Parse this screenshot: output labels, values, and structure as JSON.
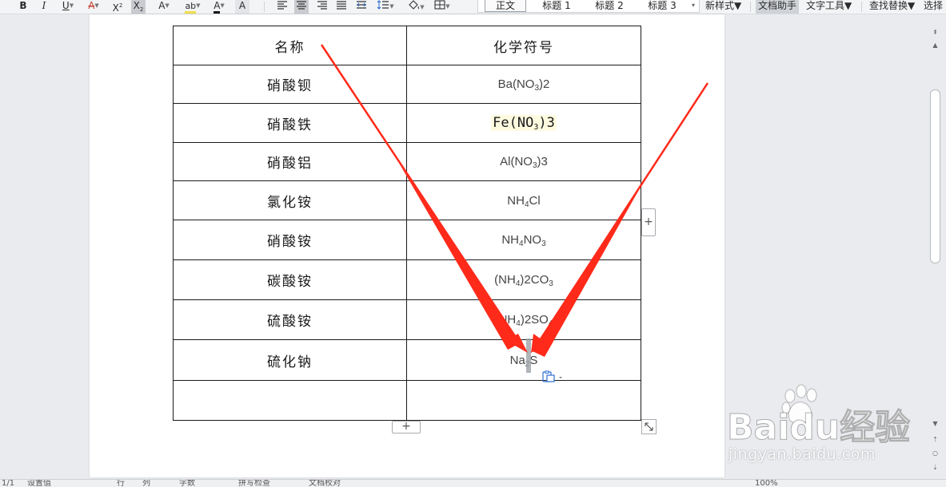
{
  "toolbar": {
    "styles": [
      "正文",
      "标题 1",
      "标题 2",
      "标题 3"
    ],
    "new_style": "新样式",
    "doc_assistant": "文档助手",
    "text_tools": "文字工具",
    "find_replace": "查找替换",
    "select": "选择"
  },
  "table": {
    "headers": {
      "name": "名称",
      "formula": "化学符号"
    },
    "rows": [
      {
        "name": "硝酸钡"
      },
      {
        "name": "硝酸铁"
      },
      {
        "name": "硝酸铝"
      },
      {
        "name": "氯化铵"
      },
      {
        "name": "硝酸铵"
      },
      {
        "name": "碳酸铵"
      },
      {
        "name": "硫酸铵"
      },
      {
        "name": "硫化钠"
      },
      {
        "name": ""
      }
    ],
    "formulas": {
      "r0": {
        "a": "Ba(NO",
        "s": "3",
        "b": ")2"
      },
      "r1": {
        "a": "Fe(NO",
        "s": "3",
        "b": ")3"
      },
      "r2": {
        "a": "Al(NO",
        "s": "3",
        "b": ")3"
      },
      "r3": {
        "a": "NH",
        "s": "4",
        "b": "Cl"
      },
      "r4": {
        "a": "NH",
        "s": "4",
        "b": "NO",
        "s2": "3"
      },
      "r5": {
        "a": "(NH",
        "s": "4",
        "b": ")2CO",
        "s2": "3"
      },
      "r6": {
        "a": "(NH",
        "s": "4",
        "b": ")2SO",
        "s2": "4"
      },
      "r7": {
        "a": "Na",
        "s": "2",
        "b": "S"
      }
    }
  },
  "controls": {
    "add_row": "+",
    "add_col": "+"
  },
  "status": {
    "page": "1/1",
    "settings": "设置值",
    "row": "行",
    "col": "列",
    "words": "字数",
    "spell": "拼写检查",
    "doc_check": "文档校对",
    "zoom": "100%"
  },
  "watermark": {
    "brand": "Baidu经验",
    "url": "jingyan.baidu.com"
  },
  "colors": {
    "arrow": "#ff2a1a",
    "highlight": "#fffbe0"
  }
}
